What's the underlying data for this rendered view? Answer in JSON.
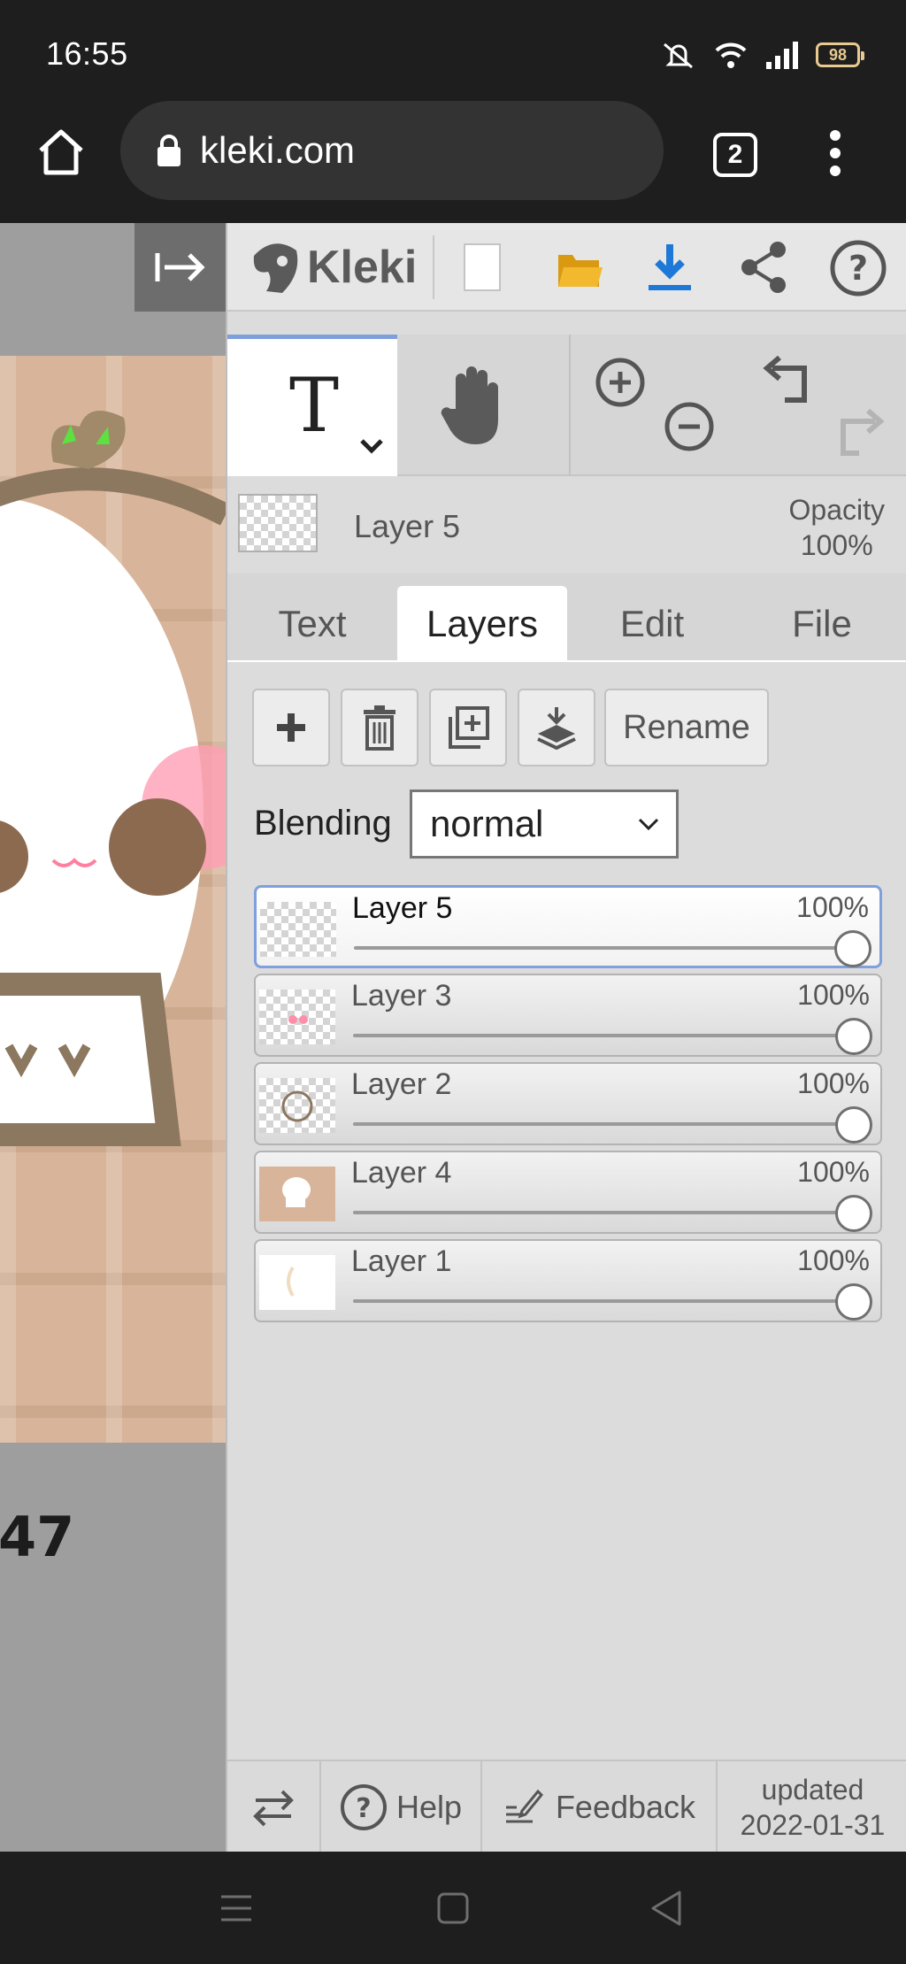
{
  "status": {
    "time": "16:55",
    "battery": "98"
  },
  "browser": {
    "url": "kleki.com",
    "tab_count": "2"
  },
  "canvas": {
    "visible_text": "47"
  },
  "app": {
    "logo_text": "Kleki"
  },
  "layer_info": {
    "current_layer": "Layer 5",
    "opacity_label": "Opacity",
    "opacity_value": "100%"
  },
  "tabs": [
    {
      "label": "Text"
    },
    {
      "label": "Layers"
    },
    {
      "label": "Edit"
    },
    {
      "label": "File"
    }
  ],
  "active_tab": "Layers",
  "layer_actions": {
    "rename_label": "Rename"
  },
  "blending": {
    "label": "Blending",
    "value": "normal"
  },
  "layers": [
    {
      "name": "Layer 5",
      "opacity_label": "100%",
      "opacity": 1.0,
      "active": true
    },
    {
      "name": "Layer 3",
      "opacity_label": "100%",
      "opacity": 1.0,
      "active": false
    },
    {
      "name": "Layer 2",
      "opacity_label": "100%",
      "opacity": 1.0,
      "active": false
    },
    {
      "name": "Layer 4",
      "opacity_label": "100%",
      "opacity": 1.0,
      "active": false
    },
    {
      "name": "Layer 1",
      "opacity_label": "100%",
      "opacity": 1.0,
      "active": false
    }
  ],
  "footer": {
    "help_label": "Help",
    "feedback_label": "Feedback",
    "updated_label": "updated",
    "updated_date": "2022-01-31"
  },
  "colors": {
    "accent_blue": "#1e78d8",
    "folder_yellow": "#f2b82e",
    "active_layer_border": "#7fa0dc"
  }
}
